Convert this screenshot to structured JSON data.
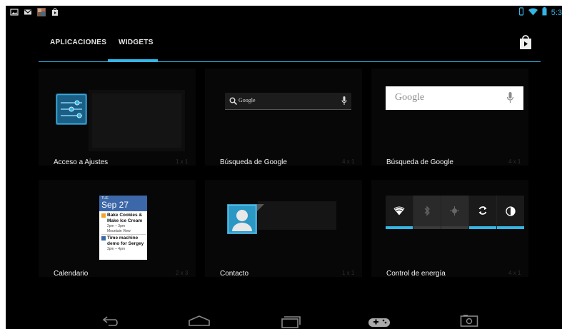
{
  "status_bar": {
    "left_icons": [
      "gallery-icon",
      "gmail-icon",
      "photo-thumbnail-icon",
      "play-store-notification-icon"
    ],
    "time": "5:3",
    "right_icons": [
      "vibrate-icon",
      "wifi-icon",
      "battery-icon"
    ]
  },
  "tabs": {
    "apps_label": "APLICACIONES",
    "widgets_label": "WIDGETS",
    "active": "WIDGETS"
  },
  "widgets": [
    {
      "label": "Acceso a Ajustes",
      "size": "1 x 1"
    },
    {
      "label": "Búsqueda de Google",
      "size": "4 x 1",
      "search_text": "Google"
    },
    {
      "label": "Búsqueda de Google",
      "size": "4 x 1",
      "search_text": "Google"
    },
    {
      "label": "Calendario",
      "size": "2 x 3",
      "calendar": {
        "day": "TUE",
        "date": "Sep 27",
        "event1_title": "Bake Cookies & Make Ice Cream",
        "event1_time": "2pm – 3pm",
        "event1_place": "Mountain View",
        "event2_title": "Time machine demo for Sergey",
        "event2_time": "3pm – 4pm"
      }
    },
    {
      "label": "Contacto",
      "size": "1 x 1"
    },
    {
      "label": "Control de energía",
      "size": "4 x 1"
    }
  ],
  "nav_bar": [
    "back-icon",
    "home-icon",
    "recent-apps-icon",
    "games-icon",
    "screenshot-icon"
  ],
  "colors": {
    "accent": "#33b5e5",
    "background": "#000000"
  }
}
